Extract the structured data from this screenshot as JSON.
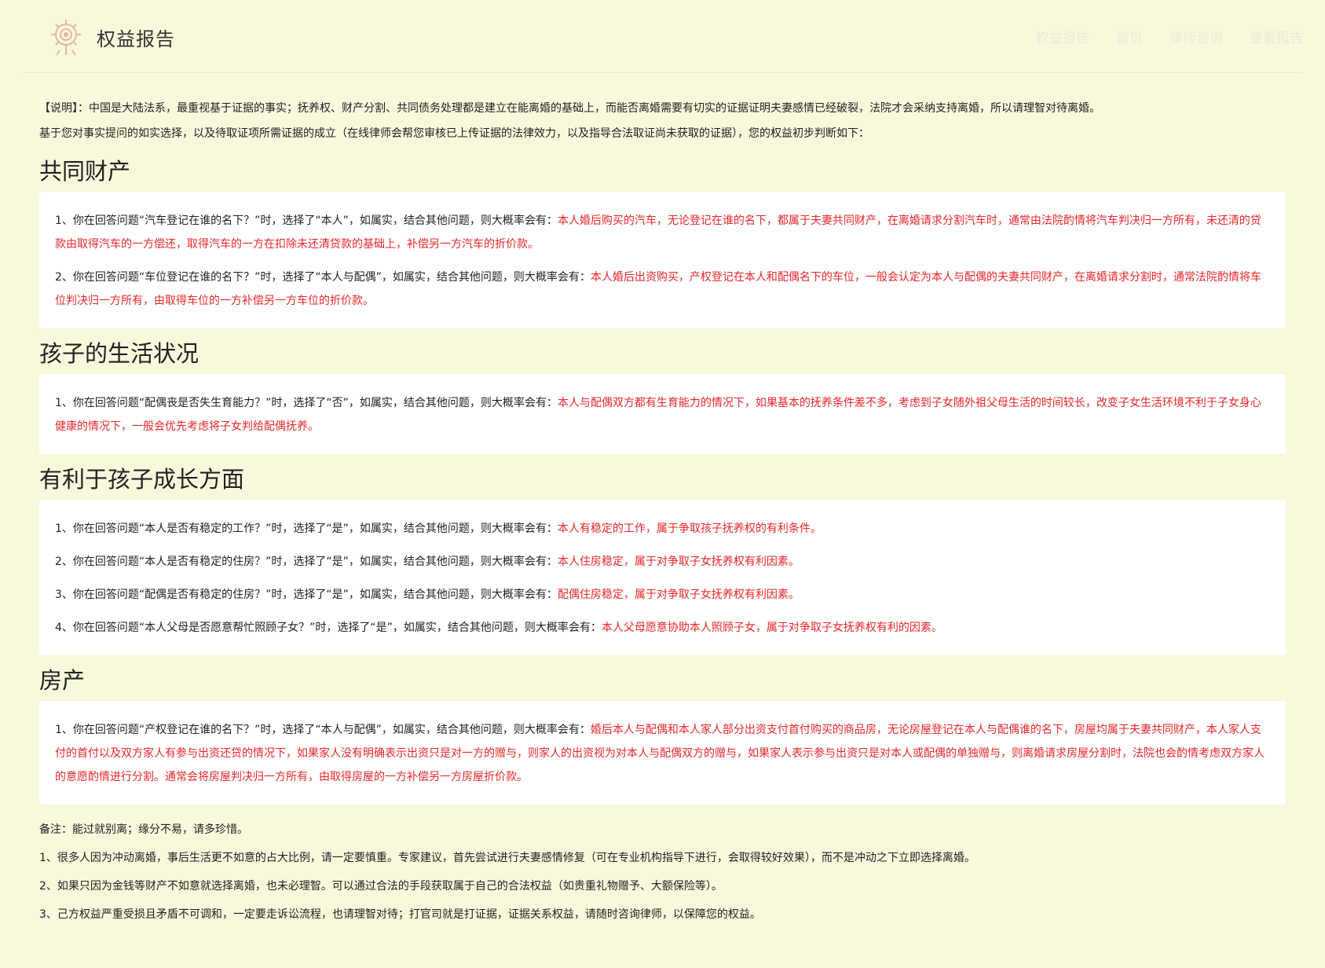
{
  "header": {
    "title": "权益报告",
    "nav": [
      "权益报告",
      "首页",
      "律师咨询",
      "查看报告"
    ]
  },
  "intro": {
    "note": "【说明】：中国是大陆法系，最重视基于证据的事实；抚养权、财产分割、共同债务处理都是建立在能离婚的基础上，而能否离婚需要有切实的证据证明夫妻感情已经破裂，法院才会采纳支持离婚，所以请理智对待离婚。",
    "basis": "基于您对事实提问的如实选择，以及待取证项所需证据的成立（在线律师会帮您审核已上传证据的法律效力，以及指导合法取证尚未获取的证据），您的权益初步判断如下："
  },
  "sections": [
    {
      "title": "共同财产",
      "items": [
        {
          "q": "1、你在回答问题“汽车登记在谁的名下？”时，选择了“本人”，如属实，结合其他问题，则大概率会有：",
          "a": "本人婚后购买的汽车，无论登记在谁的名下，都属于夫妻共同财产，在离婚请求分割汽车时，通常由法院酌情将汽车判决归一方所有，未还清的贷款由取得汽车的一方偿还，取得汽车的一方在扣除未还清贷款的基础上，补偿另一方汽车的折价款。"
        },
        {
          "q": "2、你在回答问题“车位登记在谁的名下？”时，选择了“本人与配偶”，如属实，结合其他问题，则大概率会有：",
          "a": "本人婚后出资购买，产权登记在本人和配偶名下的车位，一般会认定为本人与配偶的夫妻共同财产，在离婚请求分割时，通常法院酌情将车位判决归一方所有，由取得车位的一方补偿另一方车位的折价款。"
        }
      ]
    },
    {
      "title": "孩子的生活状况",
      "items": [
        {
          "q": "1、你在回答问题“配偶丧是否失生育能力？”时，选择了“否”，如属实，结合其他问题，则大概率会有：",
          "a": "本人与配偶双方都有生育能力的情况下，如果基本的抚养条件差不多，考虑到子女随外祖父母生活的时间较长，改变子女生活环境不利于子女身心健康的情况下，一般会优先考虑将子女判给配偶抚养。"
        }
      ]
    },
    {
      "title": "有利于孩子成长方面",
      "items": [
        {
          "q": "1、你在回答问题“本人是否有稳定的工作？”时，选择了“是”，如属实，结合其他问题，则大概率会有：",
          "a": "本人有稳定的工作，属于争取孩子抚养权的有利条件。"
        },
        {
          "q": "2、你在回答问题“本人是否有稳定的住房？”时，选择了“是”，如属实，结合其他问题，则大概率会有：",
          "a": "本人住房稳定，属于对争取子女抚养权有利因素。"
        },
        {
          "q": "3、你在回答问题“配偶是否有稳定的住房？”时，选择了“是”，如属实，结合其他问题，则大概率会有：",
          "a": "配偶住房稳定，属于对争取子女抚养权有利因素。"
        },
        {
          "q": "4、你在回答问题“本人父母是否愿意帮忙照顾子女？”时，选择了“是”，如属实，结合其他问题，则大概率会有：",
          "a": "本人父母愿意协助本人照顾子女，属于对争取子女抚养权有利的因素。"
        }
      ]
    },
    {
      "title": "房产",
      "items": [
        {
          "q": "1、你在回答问题“产权登记在谁的名下？”时，选择了“本人与配偶”，如属实，结合其他问题，则大概率会有：",
          "a": "婚后本人与配偶和本人家人部分出资支付首付购买的商品房，无论房屋登记在本人与配偶谁的名下，房屋均属于夫妻共同财产，本人家人支付的首付以及双方家人有参与出资还贷的情况下，如果家人没有明确表示出资只是对一方的赠与，则家人的出资视为对本人与配偶双方的赠与，如果家人表示参与出资只是对本人或配偶的单独赠与，则离婚请求房屋分割时，法院也会酌情考虑双方家人的意愿酌情进行分割。通常会将房屋判决归一方所有，由取得房屋的一方补偿另一方房屋折价款。"
        }
      ]
    }
  ],
  "footer": {
    "remark": "备注：能过就别离；缘分不易，请多珍惜。",
    "notes": [
      "1、很多人因为冲动离婚，事后生活更不如意的占大比例，请一定要慎重。专家建议，首先尝试进行夫妻感情修复（可在专业机构指导下进行，会取得较好效果），而不是冲动之下立即选择离婚。",
      "2、如果只因为金钱等财产不如意就选择离婚，也未必理智。可以通过合法的手段获取属于自己的合法权益（如贵重礼物赠予、大额保险等）。",
      "3、己方权益严重受损且矛盾不可调和，一定要走诉讼流程，也请理智对待；打官司就是打证据，证据关系权益，请随时咨询律师，以保障您的权益。"
    ]
  },
  "colors": {
    "background": "#f8f8dc",
    "answer": "#e8262a",
    "card": "#ffffff"
  }
}
